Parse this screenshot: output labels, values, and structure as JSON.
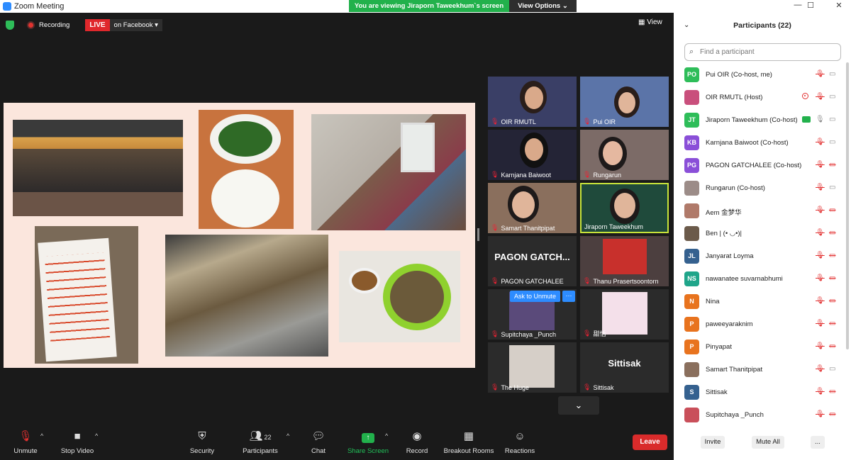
{
  "window": {
    "title": "Zoom Meeting",
    "viewing_banner": "You are viewing Jiraporn Taweekhum`s screen",
    "view_options": "View Options ⌄",
    "controls": [
      "—",
      "☐",
      "✕"
    ]
  },
  "meeting": {
    "recording_label": "Recording",
    "live_label": "LIVE",
    "live_target": "on Facebook ▾",
    "view_label": "View",
    "scroll_down": "⌄"
  },
  "tiles": [
    {
      "name": "OIR RMUTL",
      "bg": "#3a3f66"
    },
    {
      "name": "Pui OIR",
      "bg": "#5b74a8"
    },
    {
      "name": "Karnjana Baiwoot",
      "bg": "#242436"
    },
    {
      "name": "Rungarun",
      "bg": "#7c6b67"
    },
    {
      "name": "Samart Thanitpipat",
      "bg": "#8a6f5d"
    },
    {
      "name": "Jiraporn Taweekhum",
      "bg": "#1f4a3b"
    },
    {
      "name": "PAGON GATCHALEE",
      "big": "PAGON GATCH...",
      "bg": "#2b2b2b"
    },
    {
      "name": "Thanu Prasertsoontorn",
      "bg": "#4c3f3f"
    },
    {
      "name": "Supitchaya _Punch",
      "bg": "#2b2b2b"
    },
    {
      "name": "甜恬",
      "bg": "#2b2b2b"
    },
    {
      "name": "The Huge",
      "bg": "#2b2b2b"
    },
    {
      "name": "Sittisak",
      "big": "Sittisak",
      "bg": "#2b2b2b"
    }
  ],
  "ask_unmute": "Ask to Unmute",
  "more": "···",
  "toolbar": {
    "unmute": "Unmute",
    "stop_video": "Stop Video",
    "security": "Security",
    "participants": "Participants",
    "participants_count": "22",
    "chat": "Chat",
    "share_screen": "Share Screen",
    "record": "Record",
    "breakout": "Breakout Rooms",
    "reactions": "Reactions",
    "leave": "Leave"
  },
  "panel": {
    "title": "Participants (22)",
    "search_placeholder": "Find a participant",
    "invite": "Invite",
    "mute_all": "Mute All",
    "more": "..."
  },
  "participants": [
    {
      "initials": "PO",
      "color": "#2ebd59",
      "name": "Pui OIR (Co-host, me)",
      "mic": "off",
      "cam": "on"
    },
    {
      "initials": "",
      "color": "#c94f7c",
      "name": "OIR RMUTL (Host)",
      "mic": "off",
      "cam": "on",
      "rec": true
    },
    {
      "initials": "JT",
      "color": "#2ebd59",
      "name": "Jiraporn Taweekhum (Co-host)",
      "mic": "on",
      "cam": "on",
      "share": true
    },
    {
      "initials": "KB",
      "color": "#8a4fd8",
      "name": "Karnjana Baiwoot (Co-host)",
      "mic": "off",
      "cam": "on"
    },
    {
      "initials": "PG",
      "color": "#8a4fd8",
      "name": "PAGON GATCHALEE (Co-host)",
      "mic": "off",
      "cam": "off"
    },
    {
      "initials": "",
      "color": "#9c8c88",
      "name": "Rungarun (Co-host)",
      "mic": "off",
      "cam": "on"
    },
    {
      "initials": "",
      "color": "#b07a6a",
      "name": "Aem 金梦华",
      "mic": "off",
      "cam": "off"
    },
    {
      "initials": "",
      "color": "#6b5a4a",
      "name": "Ben | (• ◡•)|",
      "mic": "off",
      "cam": "off"
    },
    {
      "initials": "JL",
      "color": "#35618f",
      "name": "Janyarat Loyma",
      "mic": "off",
      "cam": "off"
    },
    {
      "initials": "NS",
      "color": "#1fa58a",
      "name": "nawanatee suvarnabhumi",
      "mic": "off",
      "cam": "off"
    },
    {
      "initials": "N",
      "color": "#e8731e",
      "name": "Nina",
      "mic": "off",
      "cam": "off"
    },
    {
      "initials": "P",
      "color": "#e8731e",
      "name": "paweeyaraknim",
      "mic": "off",
      "cam": "off"
    },
    {
      "initials": "P",
      "color": "#e8731e",
      "name": "Pinyapat",
      "mic": "off",
      "cam": "off"
    },
    {
      "initials": "",
      "color": "#8a6f5d",
      "name": "Samart Thanitpipat",
      "mic": "off",
      "cam": "on"
    },
    {
      "initials": "S",
      "color": "#35618f",
      "name": "Sittisak",
      "mic": "off",
      "cam": "off"
    },
    {
      "initials": "",
      "color": "#c94f5a",
      "name": "Supitchaya _Punch",
      "mic": "off",
      "cam": "off"
    }
  ]
}
